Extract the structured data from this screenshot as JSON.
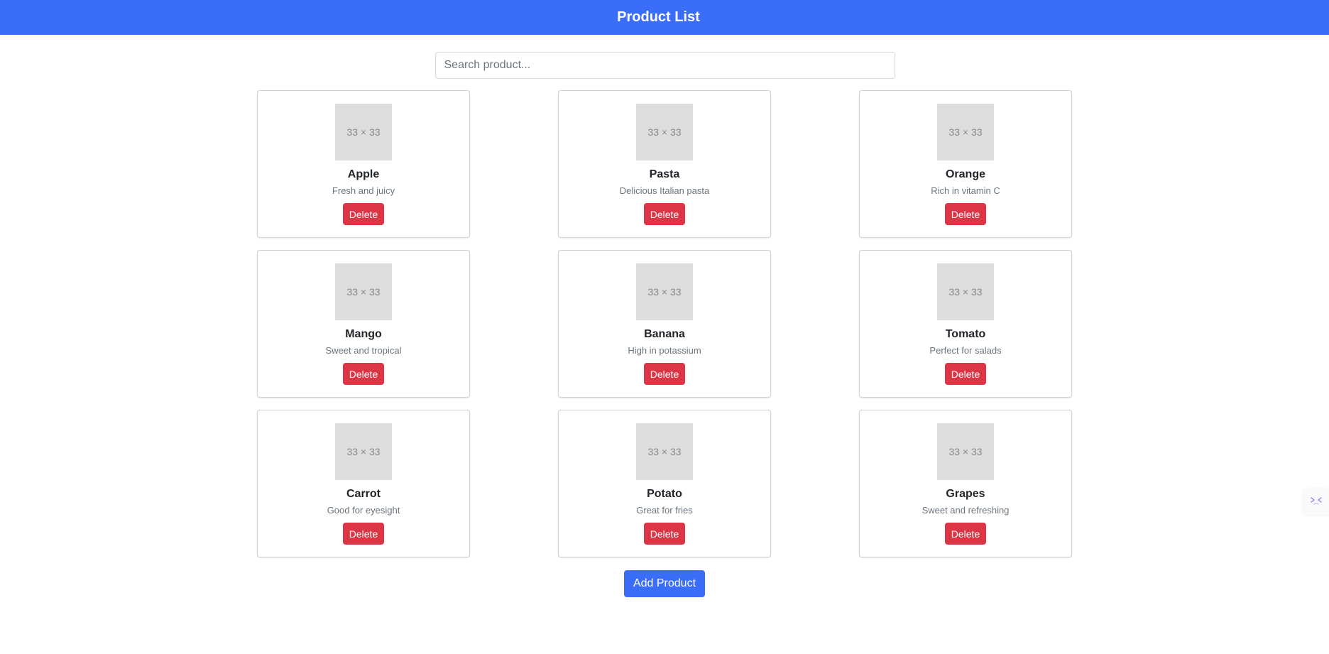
{
  "header": {
    "title": "Product List"
  },
  "search": {
    "placeholder": "Search product..."
  },
  "products": [
    {
      "thumb": "33 × 33",
      "name": "Apple",
      "description": "Fresh and juicy",
      "delete_label": "Delete"
    },
    {
      "thumb": "33 × 33",
      "name": "Pasta",
      "description": "Delicious Italian pasta",
      "delete_label": "Delete"
    },
    {
      "thumb": "33 × 33",
      "name": "Orange",
      "description": "Rich in vitamin C",
      "delete_label": "Delete"
    },
    {
      "thumb": "33 × 33",
      "name": "Mango",
      "description": "Sweet and tropical",
      "delete_label": "Delete"
    },
    {
      "thumb": "33 × 33",
      "name": "Banana",
      "description": "High in potassium",
      "delete_label": "Delete"
    },
    {
      "thumb": "33 × 33",
      "name": "Tomato",
      "description": "Perfect for salads",
      "delete_label": "Delete"
    },
    {
      "thumb": "33 × 33",
      "name": "Carrot",
      "description": "Good for eyesight",
      "delete_label": "Delete"
    },
    {
      "thumb": "33 × 33",
      "name": "Potato",
      "description": "Great for fries",
      "delete_label": "Delete"
    },
    {
      "thumb": "33 × 33",
      "name": "Grapes",
      "description": "Sweet and refreshing",
      "delete_label": "Delete"
    }
  ],
  "footer": {
    "add_label": "Add Product"
  },
  "side_widget": {
    "icon": "translate-assistant-icon"
  },
  "colors": {
    "primary": "#3b6ef8",
    "danger": "#dc3545",
    "placeholder_bg": "#dddddd"
  }
}
